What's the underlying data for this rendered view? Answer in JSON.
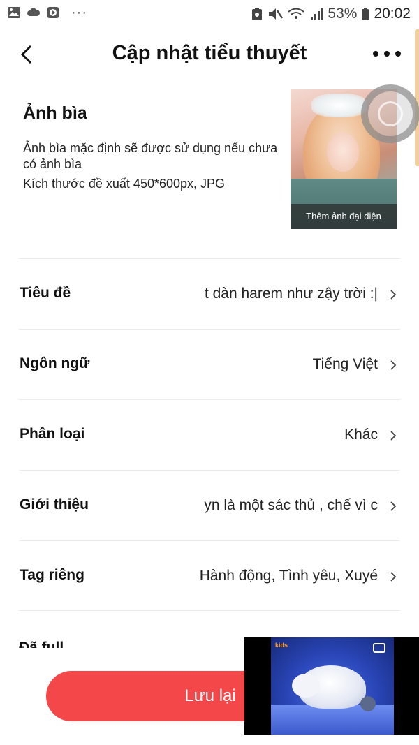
{
  "status_bar": {
    "notifications": [
      "gallery-icon",
      "cloud-icon",
      "video-app-icon"
    ],
    "more": "···",
    "battery_percent": "53%",
    "time": "20:02"
  },
  "header": {
    "title": "Cập nhật tiểu thuyết"
  },
  "cover": {
    "heading": "Ảnh bìa",
    "description": "Ảnh bìa mặc định sẽ được sử dụng nếu chưa có ảnh bìa",
    "size_hint": "Kích thước đề xuất 450*600px, JPG",
    "overlay_label": "Thêm ảnh đại diện"
  },
  "fields": [
    {
      "label": "Tiêu đề",
      "value": "t dàn harem như zậy trời :|"
    },
    {
      "label": "Ngôn ngữ",
      "value": "Tiếng Việt"
    },
    {
      "label": "Phân loại",
      "value": "Khác"
    },
    {
      "label": "Giới thiệu",
      "value": "yn là một sác thủ , chế vì c"
    },
    {
      "label": "Tag riêng",
      "value": "Hành động, Tình yêu, Xuyé"
    }
  ],
  "partial_field": {
    "label": "Đã full"
  },
  "save_button": {
    "label": "Lưu lại"
  },
  "pip_video": {
    "channel_logo": "kids"
  },
  "colors": {
    "accent": "#f4474a",
    "divider": "#ececec",
    "scroll_indicator": "#f1cf9e"
  }
}
